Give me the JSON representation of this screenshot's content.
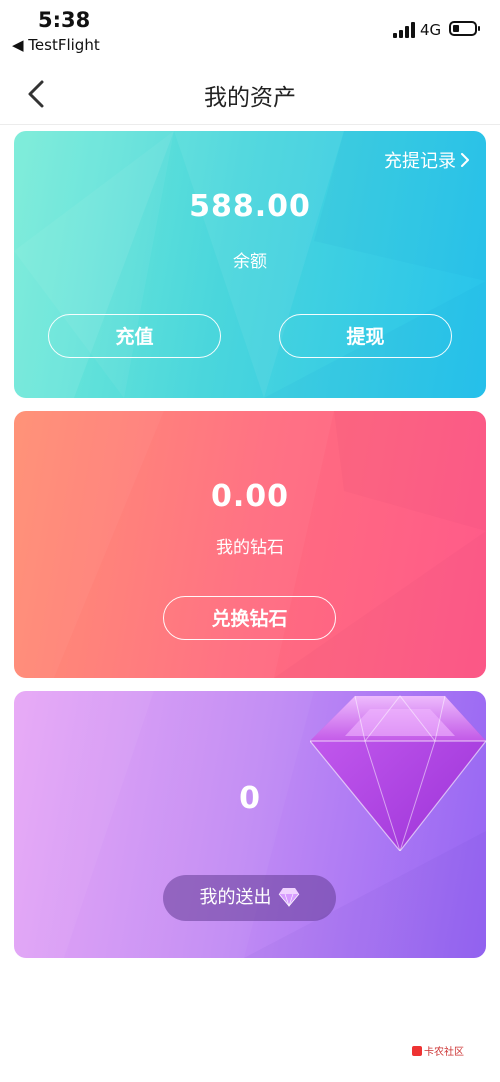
{
  "status": {
    "time": "5:38",
    "back_app": "◀ TestFlight",
    "network": "4G"
  },
  "nav": {
    "title": "我的资产"
  },
  "balance_card": {
    "record_label": "充提记录",
    "amount": "588.00",
    "label": "余额",
    "recharge_label": "充值",
    "withdraw_label": "提现"
  },
  "diamond_card": {
    "amount": "0.00",
    "label": "我的钻石",
    "exchange_label": "兑换钻石"
  },
  "sent_card": {
    "amount": "0",
    "sent_label": "我的送出"
  },
  "watermark": {
    "text": "卡农社区"
  },
  "colors": {
    "teal_start": "#76ecd7",
    "teal_end": "#27c3ec",
    "coral_start": "#ff8b6e",
    "coral_end": "#ff5a8a",
    "purple_start": "#e6a4f6",
    "purple_end": "#9565f3"
  },
  "icons": {
    "back": "chevron-left-icon",
    "record_arrow": "chevron-right-icon",
    "gem": "gem-icon"
  }
}
